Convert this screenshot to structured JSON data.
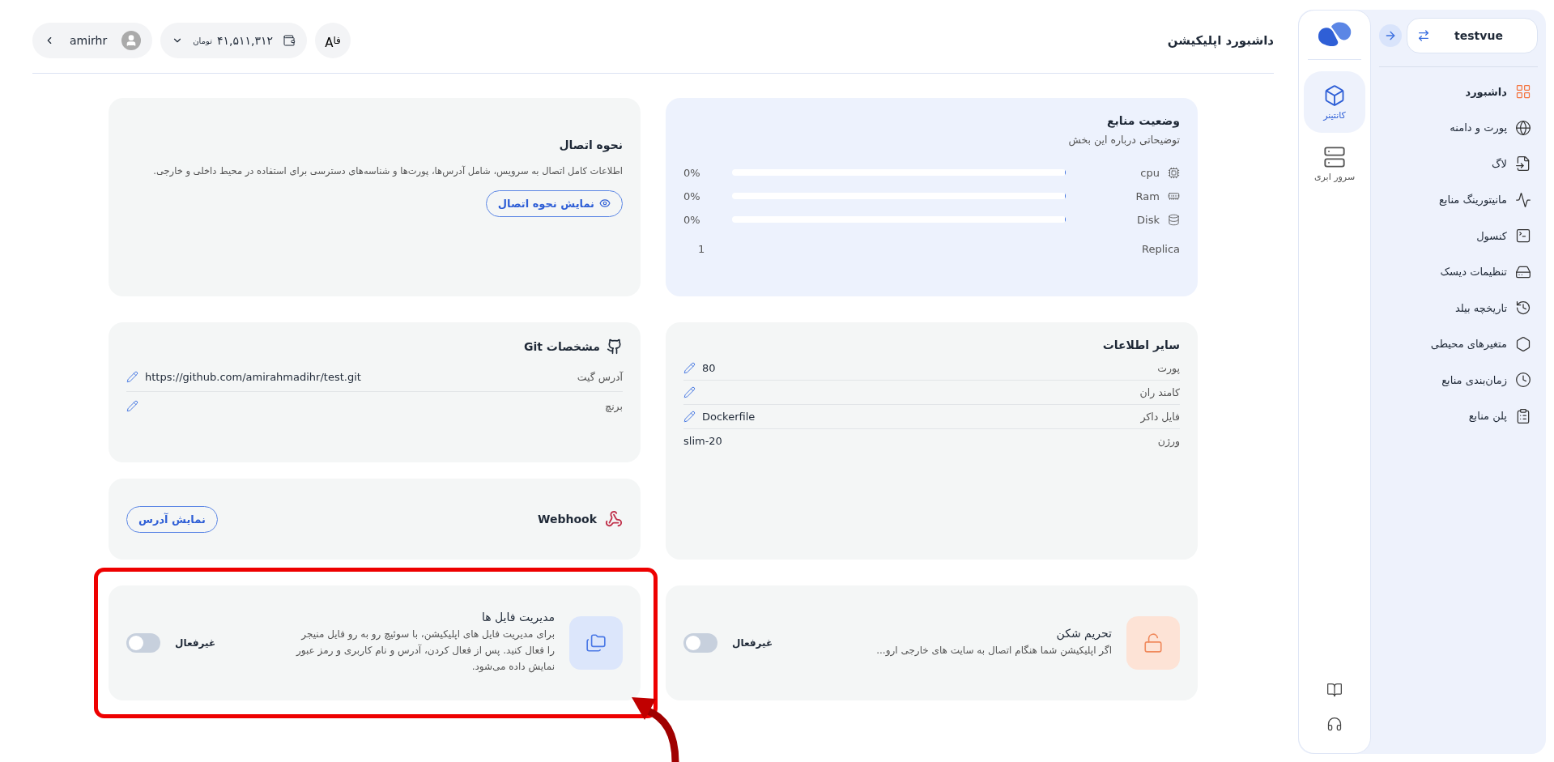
{
  "header": {
    "title": "داشبورد اپلیکیشن",
    "user": {
      "name": "amirhr"
    },
    "wallet": {
      "amount": "۴۱,۵۱۱,۳۱۲",
      "currency": "تومان"
    },
    "language": {
      "primary": "فا",
      "secondary": "A"
    }
  },
  "sidebar": {
    "app": {
      "name": "testvue"
    },
    "items": [
      {
        "label": "داشبورد",
        "kind": "grid",
        "selected": true
      },
      {
        "label": "پورت و دامنه",
        "kind": "globe",
        "selected": false
      },
      {
        "label": "لاگ",
        "kind": "file",
        "selected": false
      },
      {
        "label": "مانیتورینگ منابع",
        "kind": "monitor",
        "selected": false
      },
      {
        "label": "کنسول",
        "kind": "terminal",
        "selected": false
      },
      {
        "label": "تنظیمات دیسک",
        "kind": "disk",
        "selected": false
      },
      {
        "label": "تاریخچه بیلد",
        "kind": "history",
        "selected": false
      },
      {
        "label": "متغیرهای محیطی",
        "kind": "hexagon",
        "selected": false
      },
      {
        "label": "زمان‌بندی منابع",
        "kind": "clock",
        "selected": false
      },
      {
        "label": "پلن منابع",
        "kind": "list",
        "selected": false
      }
    ]
  },
  "rail": {
    "items": [
      {
        "label": "کانتینر",
        "kind": "box",
        "selected": true
      },
      {
        "label": "سرور ابری",
        "kind": "server",
        "selected": false
      }
    ]
  },
  "resources": {
    "title": "وضعیت منابع",
    "subtitle": "توضیحاتی درباره این بخش",
    "meters": [
      {
        "label": "cpu",
        "kind": "cpu",
        "level": 0,
        "reading": "0%"
      },
      {
        "label": "Ram",
        "kind": "ram",
        "level": 0,
        "reading": "0%"
      },
      {
        "label": "Disk",
        "kind": "disk",
        "level": 0,
        "reading": "0%"
      }
    ],
    "replica": {
      "label": "Replica",
      "value": "1"
    }
  },
  "connection": {
    "title": "نحوه اتصال",
    "description": "اطلاعات کامل اتصال به سرویس، شامل آدرس‌ها، پورت‌ها و شناسه‌های دسترسی برای استفاده در محیط داخلی و خارجی.",
    "button": "نمایش نحوه اتصال"
  },
  "other_info": {
    "title": "سایر اطلاعات",
    "rows": [
      {
        "label": "پورت",
        "value": "80",
        "editable": true
      },
      {
        "label": "کامند ران",
        "editable": true
      },
      {
        "label": "فایل داکر",
        "value": "Dockerfile",
        "editable": true
      },
      {
        "label": "ورژن",
        "value": "slim-20",
        "editable": false
      }
    ]
  },
  "git": {
    "title": "مشخصات Git",
    "rows": [
      {
        "label": "آدرس گیت",
        "value": "https://github.com/amirahmadihr/test.git"
      },
      {
        "label": "برنچ"
      }
    ]
  },
  "webhook": {
    "title": "Webhook",
    "button": "نمایش آدرس"
  },
  "features": [
    {
      "kind": "unlock",
      "title": "تحریم شکن",
      "description": "اگر اپلیکیشن شما هنگام اتصال به سایت های خارجی ارو...",
      "status": "غیرفعال",
      "on": false
    },
    {
      "kind": "folder",
      "title": "مدیریت فایل ها",
      "description": "برای مدیریت فایل های اپلیکیشن، با سوئیچ رو به رو فایل منیجر را فعال کنید. پس از فعال کردن، آدرس و نام کاربری و رمز عبور نمایش داده می‌شود.",
      "status": "غیرفعال",
      "on": false
    }
  ]
}
